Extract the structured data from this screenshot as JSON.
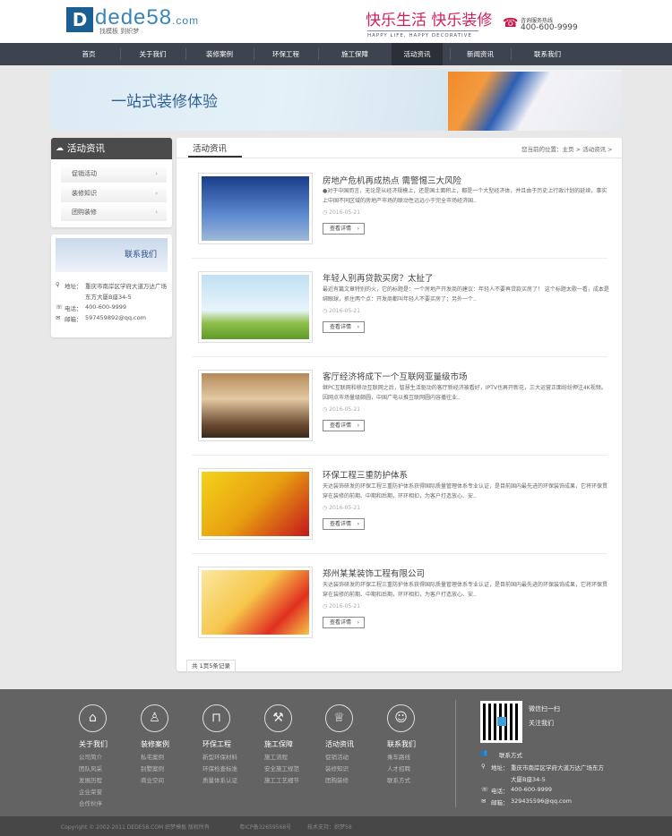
{
  "header": {
    "logo_mark": "D",
    "logo_text": "dede58",
    "logo_tld": ".com",
    "logo_sub": "找模板 到织梦",
    "slogan": "快乐生活 快乐装修",
    "slogan_en": "HAPPY LIFE, HAPPY DECORATIVE",
    "phone_label": "咨询服务热线",
    "phone": "400-600-9999"
  },
  "nav": [
    {
      "label": "首页"
    },
    {
      "label": "关于我们"
    },
    {
      "label": "装修案例"
    },
    {
      "label": "环保工程"
    },
    {
      "label": "施工保障"
    },
    {
      "label": "活动资讯",
      "active": true
    },
    {
      "label": "新闻资讯"
    },
    {
      "label": "联系我们"
    }
  ],
  "banner": {
    "title": "一站式装修体验"
  },
  "sidebar": {
    "title": "活动资讯",
    "links": [
      {
        "label": "促销活动"
      },
      {
        "label": "装修知识"
      },
      {
        "label": "团购装修"
      }
    ],
    "contact": {
      "banner": "联系我们",
      "address_label": "地址：",
      "address": "重庆市南岸区学府大道万达广场东方大厦B座34-5",
      "phone_label": "电话：",
      "phone": "400-600-9999",
      "email_label": "邮箱：",
      "email": "597459892@qq.com"
    }
  },
  "main": {
    "title": "活动资讯",
    "breadcrumb": "您当前的位置：主页 > 活动资讯 >",
    "items": [
      {
        "title": "房地产危机再成热点 需警惕三大风险",
        "desc": "●对于中国而言，无论是从经济规模上，还是国土面积上，都是一个大型经济体，并且由于历史上行政计划的延续，事实上中国不同区域的房地产市场的联动性远远小于完全市场经济国..",
        "date": "2016-05-21",
        "btn": "查看详情"
      },
      {
        "title": "年轻人别再贷款买房？太扯了",
        "desc": "最近有篇文章特别的火，它的标题是：一个房地产开发商的建议：年轻人不要再贷款买房了！ 这个标题太歌一看，成本是绑眼球，抓住两个点：开发商都叫年轻人不要买房了；另外一个..",
        "date": "2016-05-21",
        "btn": "查看详情"
      },
      {
        "title": "客厅经济将成下一个互联网亚量级市场",
        "desc": "继PC互联网和移动互联网之后，智慧生活驱动的客厅新经济被看好，IPTV也再开新花，三大运营正面纷纷押注4K视频。因网点市场量级颇圆，中国广电以推互联网圆内容播往业..",
        "date": "2016-05-21",
        "btn": "查看详情"
      },
      {
        "title": "环保工程三重防护体系",
        "desc": "天达装饰研发的环保工程三重防护体系获得国际质量管理体系专业认证，是目前国内最先进的环保装饰成果，它将环保贯穿在装修的前期、中期和后期，环环相扣，为客户打造放心、安..",
        "date": "2016-05-21",
        "btn": "查看详情"
      },
      {
        "title": "郑州某某装饰工程有限公司",
        "desc": "天达装饰研发的环保工程三重防护体系获得国际质量管理体系专业认证，是目前国内最先进的环保装饰成果，它将环保贯穿在装修的前期、中期和后期，环环相扣，为客户打造放心、安..",
        "date": "2016-05-21",
        "btn": "查看详情"
      }
    ],
    "pager": "共 1页5条记录"
  },
  "footer": {
    "cols": [
      {
        "icon": "house-icon",
        "title": "关于我们",
        "links": [
          "公司简介",
          "团队风采",
          "发展历程",
          "企业荣誉",
          "合作伙伴"
        ]
      },
      {
        "icon": "stamp-icon",
        "title": "装修案例",
        "links": [
          "私宅案例",
          "别墅案例",
          "商业空间"
        ]
      },
      {
        "icon": "paint-roller-icon",
        "title": "环保工程",
        "links": [
          "新型环保材料",
          "环保检查标准",
          "质量体系认证"
        ]
      },
      {
        "icon": "hammer-icon",
        "title": "施工保障",
        "links": [
          "施工流程",
          "安全施工规范",
          "施工工艺细节"
        ]
      },
      {
        "icon": "trophy-icon",
        "title": "活动资讯",
        "links": [
          "促销活动",
          "装修知识",
          "团购装修"
        ]
      },
      {
        "icon": "people-icon",
        "title": "联系我们",
        "links": [
          "乘车路线",
          "人才招聘",
          "联系方式"
        ]
      }
    ],
    "wechat1": "微信扫一扫",
    "wechat2": "关注我们",
    "contact_title": "联系方式",
    "address_label": "地址：",
    "address1": "重庆市南岸区学府大道万达广场东方",
    "address2": "大厦B座34-5",
    "phone_label": "电话：",
    "phone": "400-600-9999",
    "email_label": "邮箱：",
    "email": "329435596@qq.com",
    "copyright": "Copyright © 2002-2011 DEDE58.COM 织梦模板 版权所有",
    "icp": "粤ICP备32659568号",
    "support": "技术支持：织梦58"
  }
}
